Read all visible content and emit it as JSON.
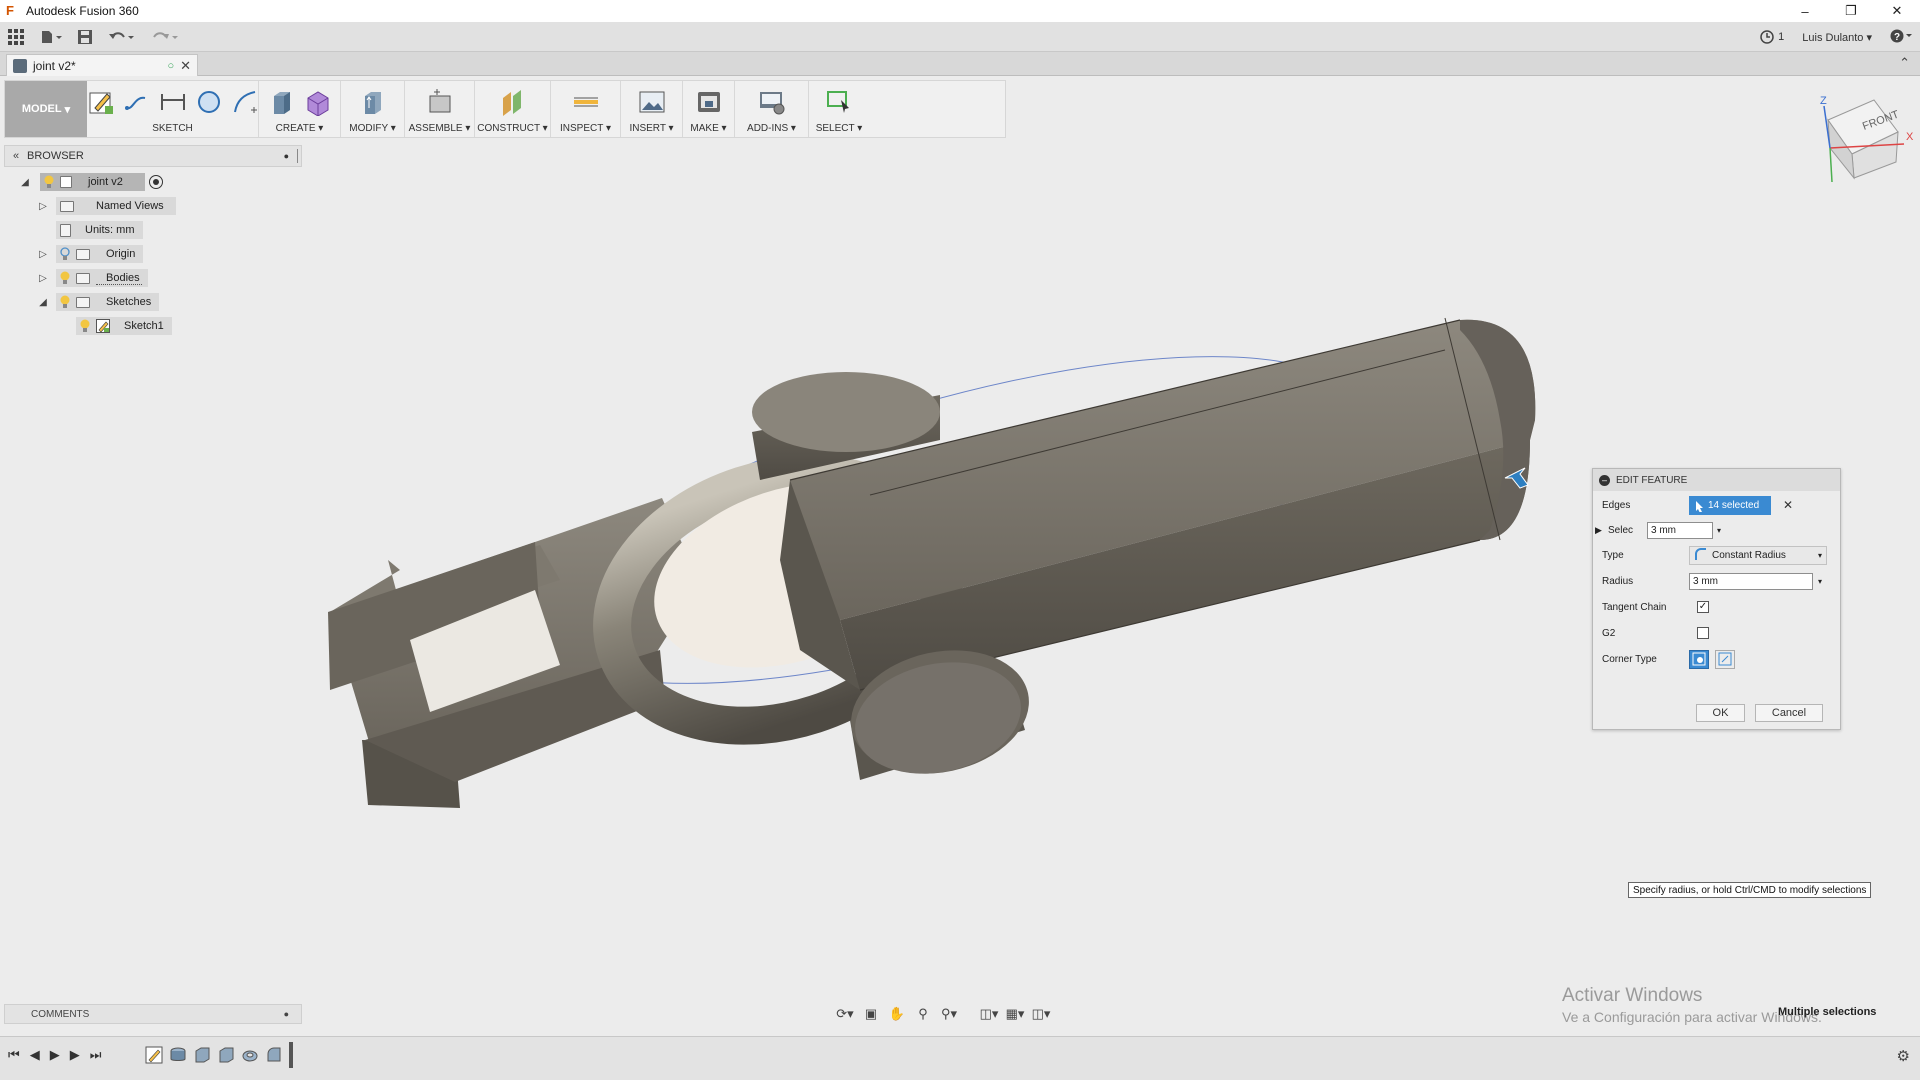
{
  "window": {
    "title": "Autodesk Fusion 360",
    "app_icon": "F"
  },
  "appbar": {
    "job_count": "1",
    "user": "Luis Dulanto"
  },
  "document_tab": {
    "name": "joint v2*"
  },
  "toolbar": {
    "workspace": "MODEL",
    "groups": [
      "SKETCH",
      "CREATE",
      "MODIFY",
      "ASSEMBLE",
      "CONSTRUCT",
      "INSPECT",
      "INSERT",
      "MAKE",
      "ADD-INS",
      "SELECT"
    ]
  },
  "browser": {
    "title": "BROWSER",
    "root": "joint v2",
    "items": [
      "Named Views",
      "Units: mm",
      "Origin",
      "Bodies",
      "Sketches",
      "Sketch1"
    ]
  },
  "viewcube": {
    "face_label": "FRONT",
    "axis_z": "Z",
    "axis_x": "X"
  },
  "edit_feature": {
    "title": "EDIT FEATURE",
    "edges_label": "Edges",
    "edges_value": "14 selected",
    "select_label": "Selec",
    "select_value": "3 mm",
    "type_label": "Type",
    "type_value": "Constant Radius",
    "radius_label": "Radius",
    "radius_value": "3 mm",
    "tangent_label": "Tangent Chain",
    "tangent_checked": true,
    "g2_label": "G2",
    "g2_checked": false,
    "corner_label": "Corner Type",
    "ok_label": "OK",
    "cancel_label": "Cancel"
  },
  "tooltip": "Specify radius, or hold Ctrl/CMD to modify selections",
  "comments": {
    "title": "COMMENTS"
  },
  "watermark": {
    "line1": "Activar Windows",
    "line2": "Ve a Configuración para activar Windows."
  },
  "status": "Multiple selections",
  "colors": {
    "accent": "#3a8ad2",
    "body": "#6f6a60",
    "panel": "#ececec"
  }
}
